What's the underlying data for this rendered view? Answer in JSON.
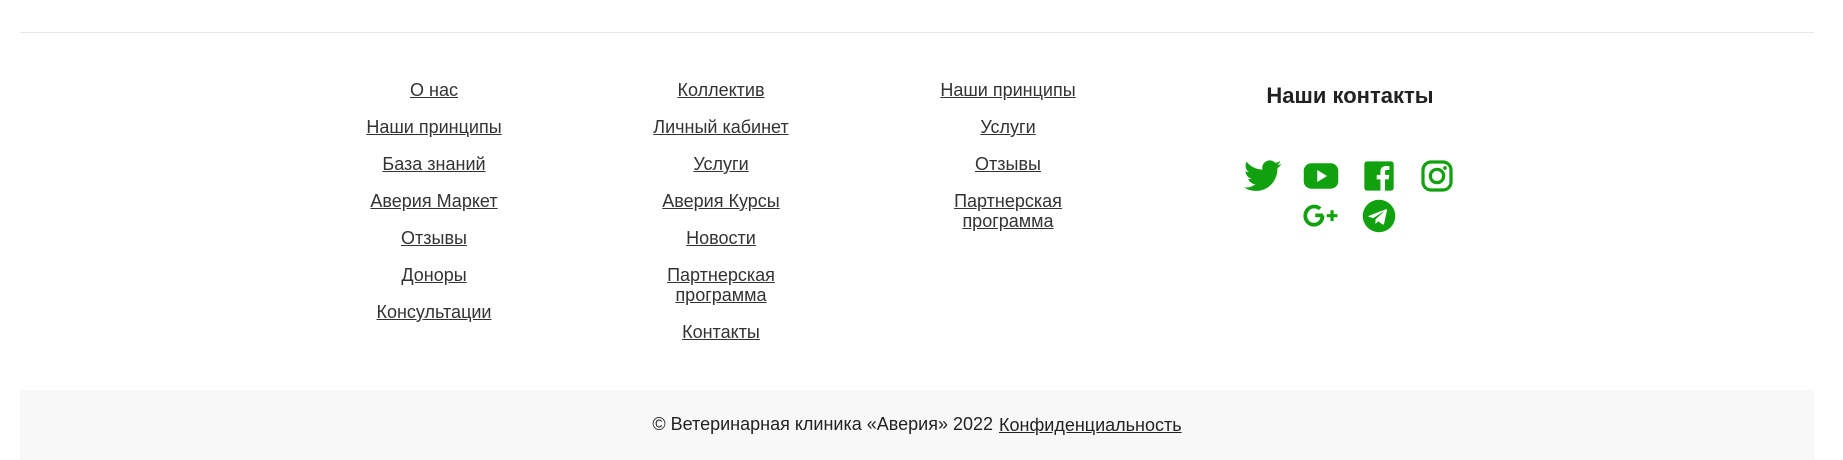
{
  "footer_nav": {
    "col1": [
      "О нас",
      "Наши принципы",
      "База знаний",
      "Аверия Маркет",
      "Отзывы",
      "Доноры",
      "Консультации"
    ],
    "col2": [
      "Коллектив",
      "Личный кабинет",
      "Услуги",
      "Аверия Курсы",
      "Новости",
      "Партнерская программа",
      "Контакты"
    ],
    "col3": [
      "Наши принципы",
      "Услуги",
      "Отзывы",
      "Партнерская программа"
    ]
  },
  "contacts": {
    "title": "Наши контакты",
    "accent_color": "#12a10e",
    "icons": [
      "twitter-icon",
      "youtube-icon",
      "facebook-icon",
      "instagram-icon",
      "google-plus-icon",
      "telegram-icon"
    ]
  },
  "bottom_bar": {
    "copyright": "© Ветеринарная клиника «Аверия» 2022",
    "privacy_link": "Конфиденциальность"
  }
}
